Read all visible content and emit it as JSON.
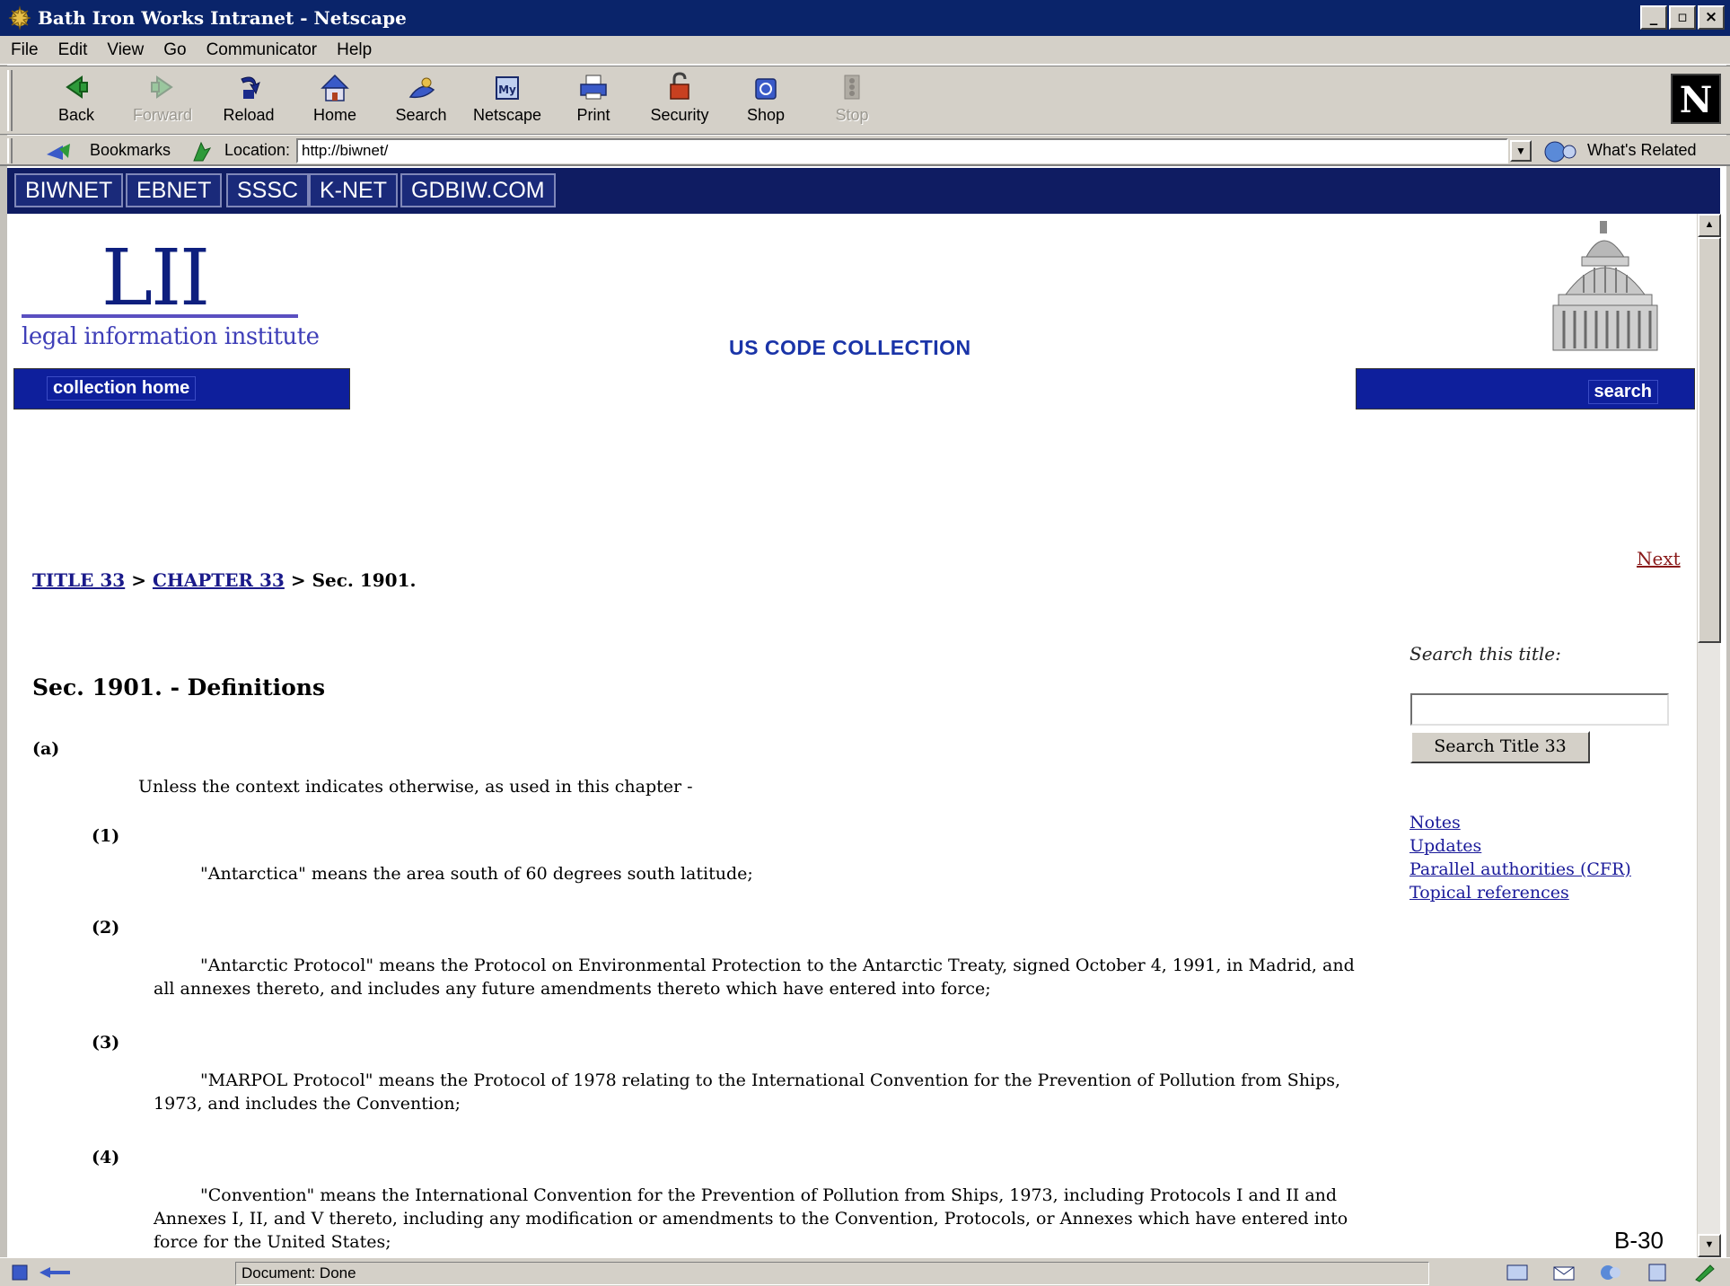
{
  "window": {
    "title": "Bath Iron Works Intranet - Netscape"
  },
  "menu": [
    "File",
    "Edit",
    "View",
    "Go",
    "Communicator",
    "Help"
  ],
  "toolbar": {
    "back": "Back",
    "forward": "Forward",
    "reload": "Reload",
    "home": "Home",
    "search": "Search",
    "netscape": "Netscape",
    "print": "Print",
    "security": "Security",
    "shop": "Shop",
    "stop": "Stop"
  },
  "location": {
    "bookmarks_label": "Bookmarks",
    "location_label": "Location:",
    "url": "http://biwnet/",
    "whats_related": "What's Related"
  },
  "intranet_nav": [
    "BIWNET",
    "EBNET",
    "SSSC",
    "K-NET",
    "GDBIW.COM"
  ],
  "header": {
    "logo": "LII",
    "logo_sub": "legal information institute",
    "collection_title": "US CODE COLLECTION",
    "collection_home": "collection home",
    "search": "search"
  },
  "nav": {
    "next": "Next"
  },
  "breadcrumb": {
    "title": "TITLE 33",
    "sep1": ">",
    "chapter": "CHAPTER 33",
    "sep2": ">",
    "section": "Sec. 1901."
  },
  "sidebar": {
    "search_label": "Search this title:",
    "search_value": "",
    "search_button": "Search Title 33",
    "links": [
      "Notes",
      "Updates",
      "Parallel authorities (CFR)",
      "Topical references"
    ]
  },
  "section": {
    "heading": "Sec. 1901. - Definitions",
    "a_label": "(a)",
    "a_intro": "Unless the context indicates otherwise, as used in this chapter -",
    "items": [
      {
        "label": "(1)",
        "text": "\"Antarctica\" means the area south of 60 degrees south latitude;"
      },
      {
        "label": "(2)",
        "text": "\"Antarctic Protocol\" means the Protocol on Environmental Protection to the Antarctic Treaty, signed October 4, 1991, in Madrid, and all annexes thereto, and includes any future amendments thereto which have entered into force;"
      },
      {
        "label": "(3)",
        "text": "\"MARPOL Protocol\" means the Protocol of 1978 relating to the International Convention for the Prevention of Pollution from Ships, 1973, and includes the Convention;"
      },
      {
        "label": "(4)",
        "text": "\"Convention\" means the International Convention for the Prevention of Pollution from Ships, 1973, including Protocols I and II and Annexes I, II, and V thereto, including any modification or amendments to the Convention, Protocols, or Annexes which have entered into force for the United States;"
      }
    ]
  },
  "page_code": "B-30",
  "status": {
    "text": "Document: Done"
  }
}
